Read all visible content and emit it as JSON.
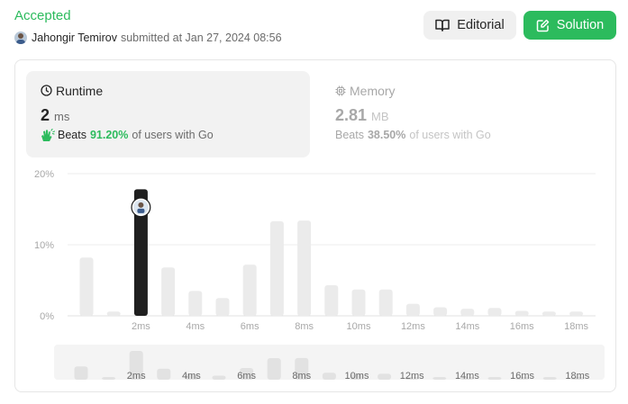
{
  "header": {
    "status": "Accepted",
    "user_name": "Jahongir Temirov",
    "submitted_text": "submitted at Jan 27, 2024 08:56",
    "editorial_label": "Editorial",
    "solution_label": "Solution"
  },
  "runtime": {
    "title": "Runtime",
    "value": "2",
    "unit": "ms",
    "beats_label": "Beats",
    "beats_pct": "91.20%",
    "beats_rest": "of users with Go"
  },
  "memory": {
    "title": "Memory",
    "value": "2.81",
    "unit": "MB",
    "beats_label": "Beats",
    "beats_pct": "38.50%",
    "beats_rest": "of users with Go"
  },
  "colors": {
    "accent": "#2cbb5d",
    "bar": "#ebebeb",
    "selected_bar": "#1f1f1f"
  },
  "chart_data": {
    "type": "bar",
    "unit": "%",
    "ylim": [
      0,
      20
    ],
    "y_ticks": [
      "0%",
      "10%",
      "20%"
    ],
    "x_tick_labels": [
      "2ms",
      "4ms",
      "6ms",
      "8ms",
      "10ms",
      "12ms",
      "14ms",
      "16ms",
      "18ms"
    ],
    "values": [
      8.2,
      0.6,
      17.8,
      6.8,
      3.5,
      2.5,
      7.2,
      13.3,
      13.4,
      4.3,
      3.7,
      3.7,
      1.7,
      1.2,
      1.0,
      1.1,
      0.7,
      0.6,
      0.6
    ],
    "selected_index": 2,
    "grid": true
  },
  "nav_chart": {
    "x_tick_labels": [
      "2ms",
      "4ms",
      "6ms",
      "8ms",
      "10ms",
      "12ms",
      "14ms",
      "16ms",
      "18ms"
    ]
  }
}
